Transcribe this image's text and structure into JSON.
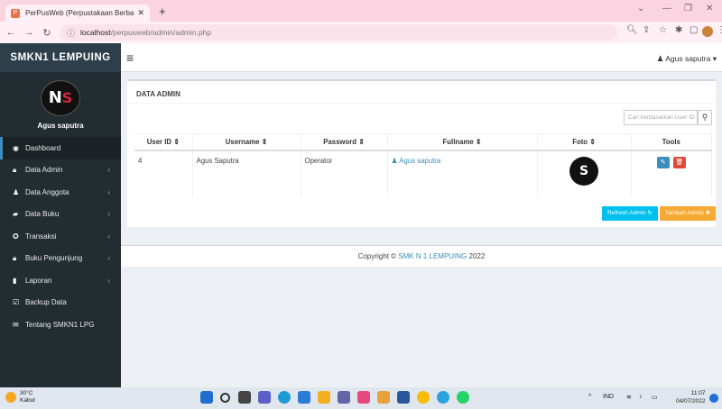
{
  "browser": {
    "tab_title": "PerPusWeb (Perpustakaan Berba",
    "url_host": "localhost",
    "url_path": "/perpusweb/admin/admin.php"
  },
  "header": {
    "brand": "SMKN1 LEMPUING",
    "user": "Agus saputra"
  },
  "sidebar": {
    "user_name": "Agus saputra",
    "items": [
      {
        "label": "Dashboard",
        "icon": "dashboard-icon",
        "has_arrow": false
      },
      {
        "label": "Data Admin",
        "icon": "lock-icon",
        "has_arrow": true
      },
      {
        "label": "Data Anggota",
        "icon": "user-icon",
        "has_arrow": true
      },
      {
        "label": "Data Buku",
        "icon": "book-icon",
        "has_arrow": true
      },
      {
        "label": "Transaksi",
        "icon": "transaction-icon",
        "has_arrow": true
      },
      {
        "label": "Buku Pengunjung",
        "icon": "lock-icon",
        "has_arrow": true
      },
      {
        "label": "Laporan",
        "icon": "file-icon",
        "has_arrow": true
      },
      {
        "label": "Backup Data",
        "icon": "check-icon",
        "has_arrow": false
      },
      {
        "label": "Tentang SMKN1 LPG",
        "icon": "envelope-icon",
        "has_arrow": false
      }
    ]
  },
  "main": {
    "title": "DATA ADMIN",
    "search_placeholder": "Cari berdasarkan User ID",
    "columns": [
      "User ID",
      "Username",
      "Password",
      "Fullname",
      "Foto",
      "Tools"
    ],
    "rows": [
      {
        "user_id": "4",
        "username": "Agus Saputra",
        "password": "Operator",
        "fullname": "Agus saputra"
      }
    ],
    "refresh_label": "Refresh Admin",
    "add_label": "Tambah Admin"
  },
  "footer": {
    "prefix": "Copyright ©",
    "link": "SMK N 1 LEMPUING",
    "year": "2022"
  },
  "taskbar": {
    "temp": "30°C",
    "weather": "Kabut",
    "lang": "IND",
    "time": "11:07",
    "date": "04/07/2022"
  },
  "colors": {
    "sidebar_bg": "#222d32",
    "brand_bg": "#2d3f4b",
    "accent": "#3c8dbc",
    "refresh": "#00c0ef",
    "add": "#f39c12",
    "delete": "#dd4b39"
  }
}
